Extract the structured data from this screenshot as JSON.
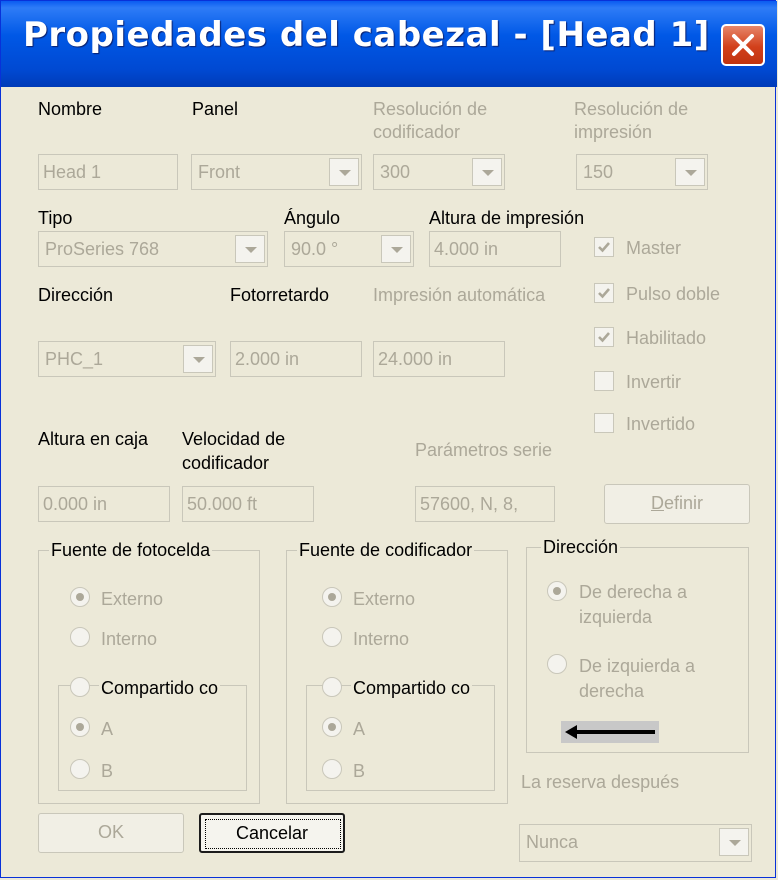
{
  "window": {
    "title": "Propiedades del cabezal - [Head 1]"
  },
  "labels": {
    "nombre": "Nombre",
    "panel": "Panel",
    "res_codificador": [
      "Resolución de",
      "codificador"
    ],
    "res_impresion": [
      "Resolución de",
      "impresión"
    ],
    "tipo": "Tipo",
    "angulo": "Ángulo",
    "altura_impresion": "Altura de impresión",
    "direccion": "Dirección",
    "fotorretardo": "Fotorretardo",
    "impresion_auto": "Impresión automática",
    "altura_caja": "Altura en caja",
    "velocidad": [
      "Velocidad de",
      "codificador"
    ],
    "parametros": "Parámetros serie",
    "reserva": "La reserva después"
  },
  "fields": {
    "nombre": "Head 1",
    "panel": "Front",
    "res_codificador": "300",
    "res_impresion": "150",
    "tipo": "ProSeries 768",
    "angulo": "90.0 °",
    "altura_impresion": "4.000 in",
    "direccion": "PHC_1",
    "fotorretardo": "2.000 in",
    "impresion_auto": "24.000 in",
    "altura_caja": "0.000 in",
    "velocidad": "50.000 ft",
    "parametros": "57600, N, 8,",
    "reserva": "Nunca"
  },
  "checkboxes": [
    {
      "label": "Master",
      "checked": true
    },
    {
      "label": "Pulso doble",
      "checked": true
    },
    {
      "label": "Habilitado",
      "checked": true
    },
    {
      "label": "Invertir",
      "checked": false
    },
    {
      "label": "Invertido",
      "checked": false
    }
  ],
  "groups": {
    "fotocelda": {
      "title": "Fuente de fotocelda",
      "externo": "Externo",
      "interno": "Interno",
      "compartido": "Compartido co",
      "a": "A",
      "b": "B"
    },
    "codificador": {
      "title": "Fuente de codificador",
      "externo": "Externo",
      "interno": "Interno",
      "compartido": "Compartido co",
      "a": "A",
      "b": "B"
    },
    "direccion": {
      "title": "Dirección",
      "opt1": [
        "De derecha a",
        "izquierda"
      ],
      "opt2": [
        "De izquierda a",
        "derecha"
      ]
    }
  },
  "buttons": {
    "definir_prefix": "D",
    "definir_rest": "efinir",
    "ok": "OK",
    "cancelar": "Cancelar"
  },
  "colors": {
    "title_bar": "#0058e6",
    "disabled_text": "#aca899",
    "background": "#ece9d8",
    "close_button": "#d2401b"
  }
}
